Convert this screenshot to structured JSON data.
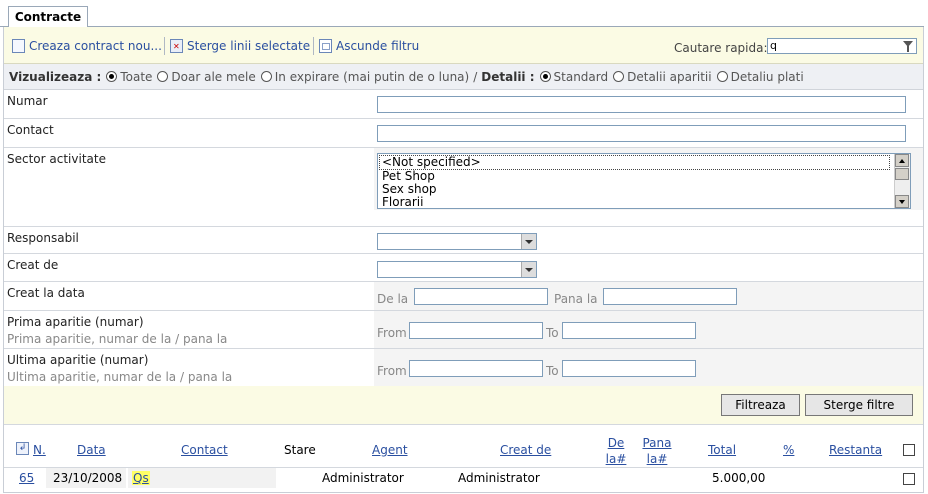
{
  "tab": {
    "label": "Contracte"
  },
  "toolbar": {
    "create_label": "Creaza contract nou...",
    "delete_label": "Sterge linii selectate",
    "hide_filter_label": "Ascunde filtru",
    "quick_search_label": "Cautare rapida:",
    "quick_search_value": "q"
  },
  "view": {
    "label": "Vizualizeaza :",
    "options": [
      "Toate",
      "Doar ale mele",
      "In expirare (mai putin de o luna)"
    ],
    "selected": "Toate",
    "details_sep": "/",
    "details_label": "Detalii :",
    "details_options": [
      "Standard",
      "Detalii aparitii",
      "Detaliu plati"
    ],
    "details_selected": "Standard"
  },
  "filters": {
    "numar": {
      "label": "Numar",
      "value": ""
    },
    "contact": {
      "label": "Contact",
      "value": ""
    },
    "sector": {
      "label": "Sector activitate",
      "options": [
        "<Not specified>",
        "Pet Shop",
        "Sex shop",
        "Florarii"
      ]
    },
    "responsabil": {
      "label": "Responsabil",
      "value": ""
    },
    "creat_de": {
      "label": "Creat de",
      "value": ""
    },
    "creat_la_data": {
      "label": "Creat la data",
      "from_label": "De la",
      "to_label": "Pana la"
    },
    "prima_aparitie": {
      "label": "Prima aparitie (numar)",
      "sub": "Prima aparitie, numar de la / pana la",
      "from_label": "From",
      "to_label": "To"
    },
    "ultima_aparitie": {
      "label": "Ultima aparitie (numar)",
      "sub": "Ultima aparitie, numar de la / pana la",
      "from_label": "From",
      "to_label": "To"
    }
  },
  "buttons": {
    "filter": "Filtreaza",
    "clear": "Sterge filtre"
  },
  "table": {
    "columns": {
      "nr": "N.",
      "data": "Data",
      "contact": "Contact",
      "stare": "Stare",
      "agent": "Agent",
      "creat_de": "Creat de",
      "de_la_1": "De",
      "de_la_2": "la#",
      "pana_la_1": "Pana",
      "pana_la_2": "la#",
      "total": "Total",
      "pct": "%",
      "restanta": "Restanta"
    },
    "rows": [
      {
        "nr": "65",
        "data": "23/10/2008",
        "contact": "Qs",
        "stare": "",
        "agent": "Administrator",
        "creat_de": "Administrator",
        "total": "5.000,00"
      }
    ]
  }
}
